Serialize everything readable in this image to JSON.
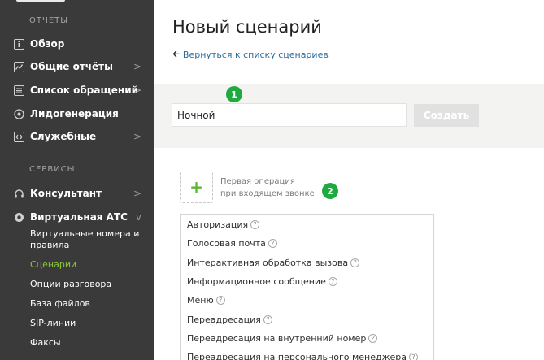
{
  "sidebar": {
    "sections": {
      "reports": "ОТЧЕТЫ",
      "services": "СЕРВИСЫ"
    },
    "items": [
      {
        "label": "Обзор",
        "icon": "info-square-icon",
        "chevron": ""
      },
      {
        "label": "Общие отчёты",
        "icon": "chart-square-icon",
        "chevron": ">"
      },
      {
        "label": "Список обращений",
        "icon": "list-square-icon",
        "chevron": ">"
      },
      {
        "label": "Лидогенерация",
        "icon": "lead-icon",
        "chevron": ""
      },
      {
        "label": "Служебные",
        "icon": "code-square-icon",
        "chevron": ">"
      },
      {
        "label": "Консультант",
        "icon": "headset-icon",
        "chevron": ">"
      },
      {
        "label": "Виртуальная АТС",
        "icon": "phone-station-icon",
        "chevron": "v"
      }
    ],
    "subitems": [
      {
        "label": "Виртуальные номера и правила",
        "active": false
      },
      {
        "label": "Сценарии",
        "active": true
      },
      {
        "label": "Опции разговора",
        "active": false
      },
      {
        "label": "База файлов",
        "active": false
      },
      {
        "label": "SIP-линии",
        "active": false
      },
      {
        "label": "Факсы",
        "active": false
      }
    ]
  },
  "main": {
    "title": "Новый сценарий",
    "back_link": "Вернуться к списку сценариев",
    "name_input_value": "Ночной",
    "create_button": "Создать",
    "badge_1": "1",
    "badge_2": "2",
    "first_op_line1": "Первая операция",
    "first_op_line2": "при входящем звонке",
    "add_symbol": "+",
    "help_symbol": "?",
    "operations": [
      "Авторизация",
      "Голосовая почта",
      "Интерактивная обработка вызова",
      "Информационное сообщение",
      "Меню",
      "Переадресация",
      "Переадресация на внутренний номер",
      "Переадресация на персонального менеджера"
    ]
  },
  "colors": {
    "sidebar_bg": "#3a3a3a",
    "accent_green": "#8cc63e",
    "badge_green": "#1eaa3f",
    "link_blue": "#2a6ea0"
  }
}
